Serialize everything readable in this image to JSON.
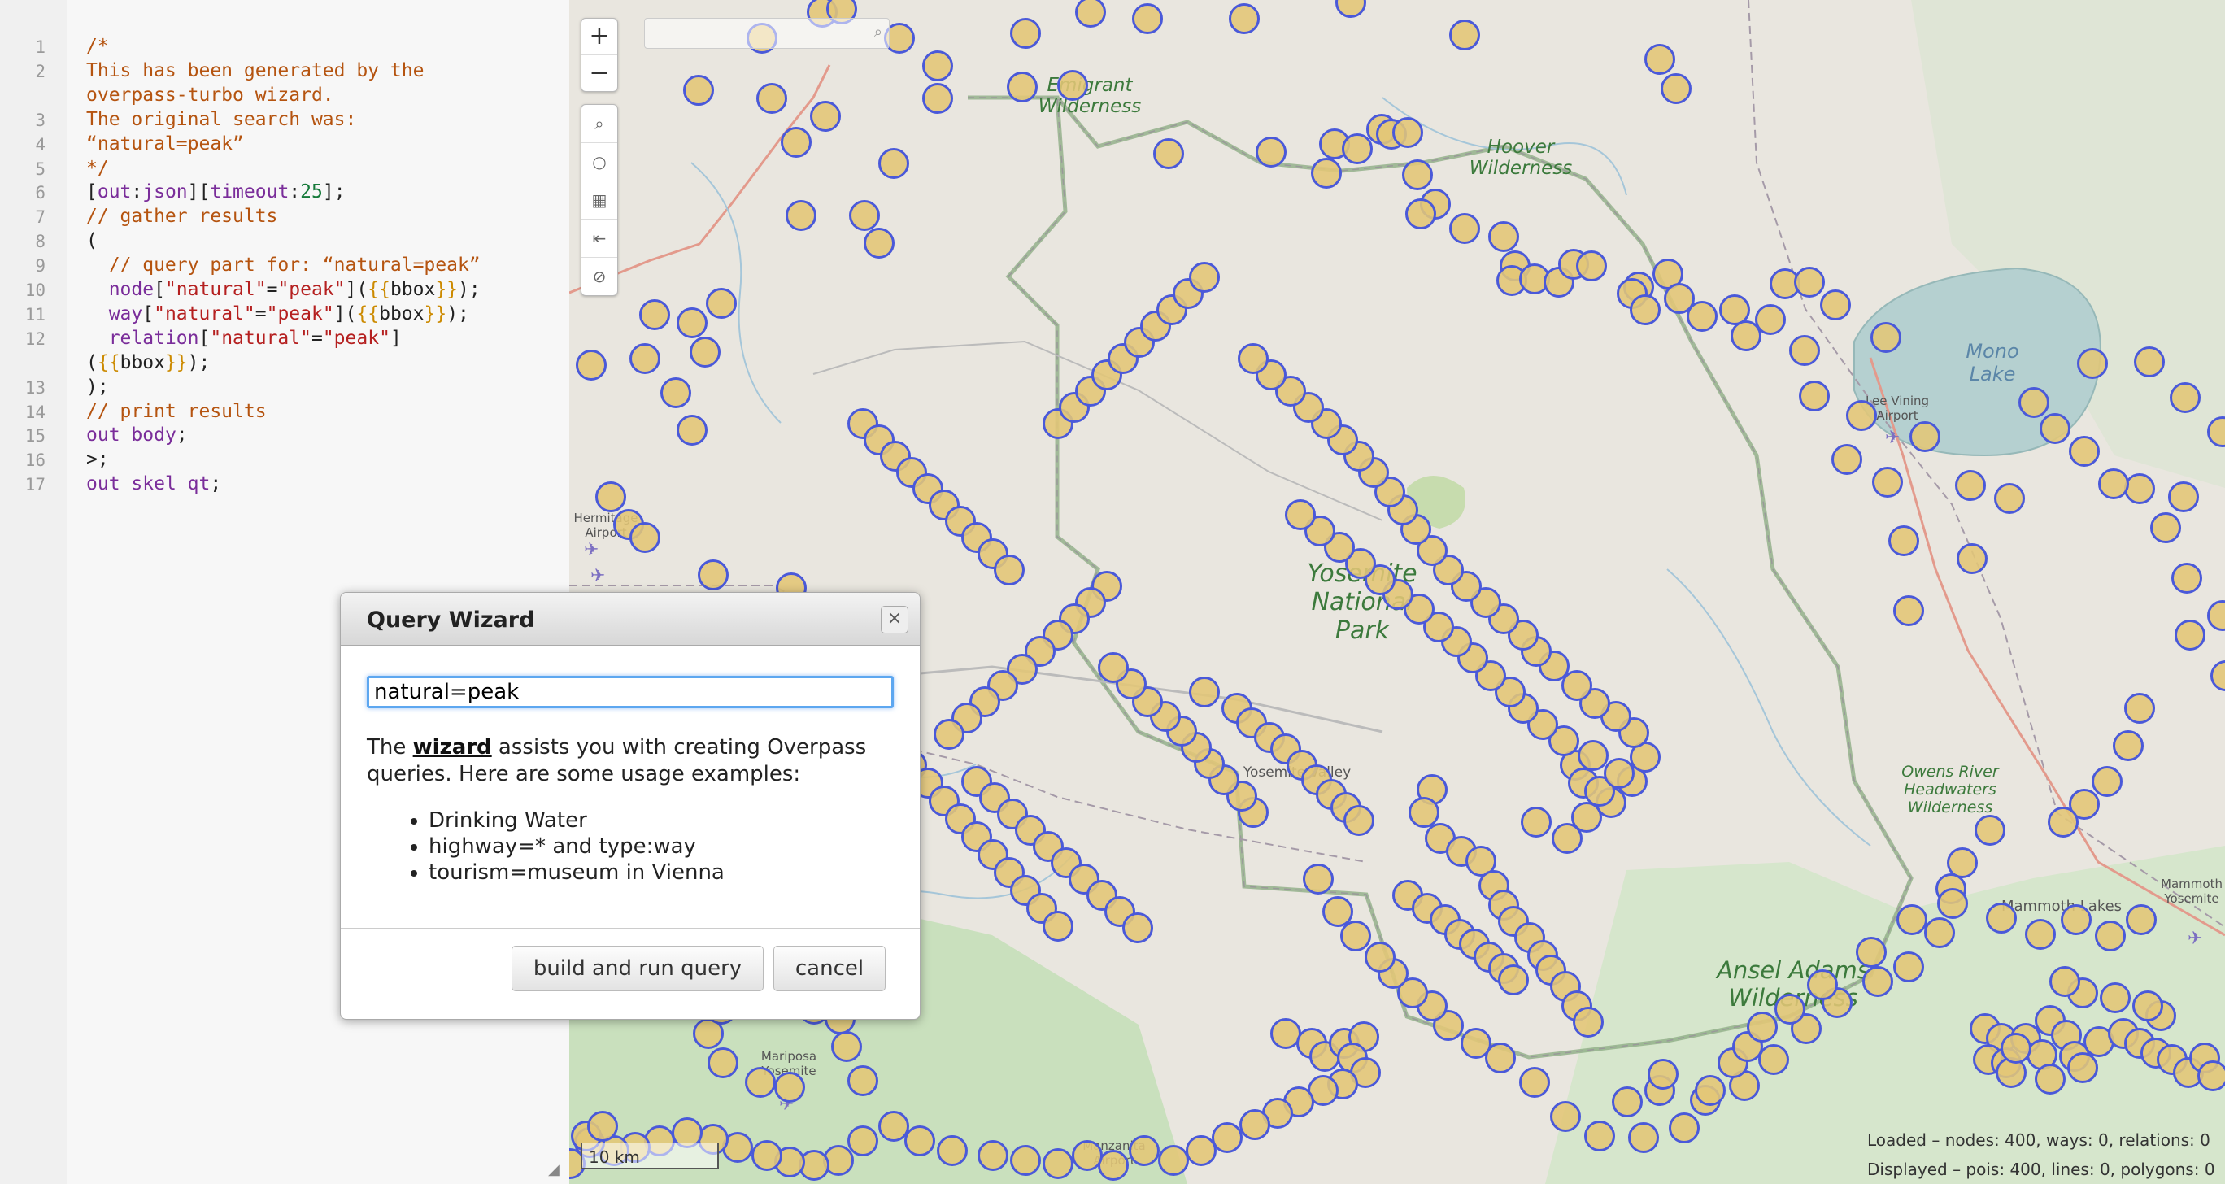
{
  "editor": {
    "lines": [
      {
        "n": "1",
        "t": "/*",
        "c": "cm"
      },
      {
        "n": "2",
        "t": "This has been generated by the",
        "c": "cm"
      },
      {
        "n": "",
        "t": "overpass-turbo wizard.",
        "c": "cm"
      },
      {
        "n": "3",
        "t": "The original search was:",
        "c": "cm"
      },
      {
        "n": "4",
        "t": "“natural=peak”",
        "c": "cm"
      },
      {
        "n": "5",
        "t": "*/",
        "c": "cm"
      },
      {
        "n": "6",
        "t": "[out:json][timeout:25];",
        "c": "code"
      },
      {
        "n": "7",
        "t": "// gather results",
        "c": "cm"
      },
      {
        "n": "8",
        "t": "(",
        "c": "code"
      },
      {
        "n": "9",
        "t": "  // query part for: “natural=peak”",
        "c": "cm"
      },
      {
        "n": "10",
        "t": "  node[\"natural\"=\"peak\"]({{bbox}});",
        "c": "code"
      },
      {
        "n": "11",
        "t": "  way[\"natural\"=\"peak\"]({{bbox}});",
        "c": "code"
      },
      {
        "n": "12",
        "t": "  relation[\"natural\"=\"peak\"]",
        "c": "code"
      },
      {
        "n": "",
        "t": "({{bbox}});",
        "c": "code"
      },
      {
        "n": "13",
        "t": ");",
        "c": "code"
      },
      {
        "n": "14",
        "t": "// print results",
        "c": "cm"
      },
      {
        "n": "15",
        "t": "out body;",
        "c": "code"
      },
      {
        "n": "16",
        "t": ">;",
        "c": "code"
      },
      {
        "n": "17",
        "t": "out skel qt;",
        "c": "code"
      }
    ]
  },
  "map": {
    "zoom_in": "+",
    "zoom_out": "−",
    "search_placeholder": "",
    "scale_label": "10 km",
    "stats": {
      "loaded": "Loaded – nodes: 400, ways: 0, relations: 0",
      "displayed": "Displayed – pois: 400, lines: 0, polygons: 0"
    },
    "labels": {
      "emigrant": "Emigrant Wilderness",
      "hoover": "Hoover Wilderness",
      "yosemite": "Yosemite National Park",
      "mono": "Mono Lake",
      "lee_vining": "Lee Vining Airport",
      "hermitage": "Hermitage Airport",
      "yosemite_valley": "Yosemite Valley",
      "owens": "Owens River Headwaters Wilderness",
      "mammoth": "Mammoth Lakes",
      "mammoth_yosemite": "Mammoth Yosemite",
      "ansel": "Ansel Adams Wilderness",
      "mariposa": "Mariposa Yosemite",
      "manzanita": "Manzanita Airport"
    },
    "colors": {
      "pin_border": "#4a59d9",
      "pin_fill": "#e2c676",
      "park": "#cfe3c2",
      "water": "#b5d0d0"
    },
    "poi_count": 400
  },
  "dialog": {
    "title": "Query Wizard",
    "close": "×",
    "input_value": "natural=peak",
    "text_before": "The ",
    "link": "wizard",
    "text_after": " assists you with creating Overpass queries. Here are some usage examples:",
    "examples": [
      "Drinking Water",
      "highway=* and type:way",
      "tourism=museum in Vienna"
    ],
    "run_button": "build and run query",
    "cancel_button": "cancel"
  }
}
